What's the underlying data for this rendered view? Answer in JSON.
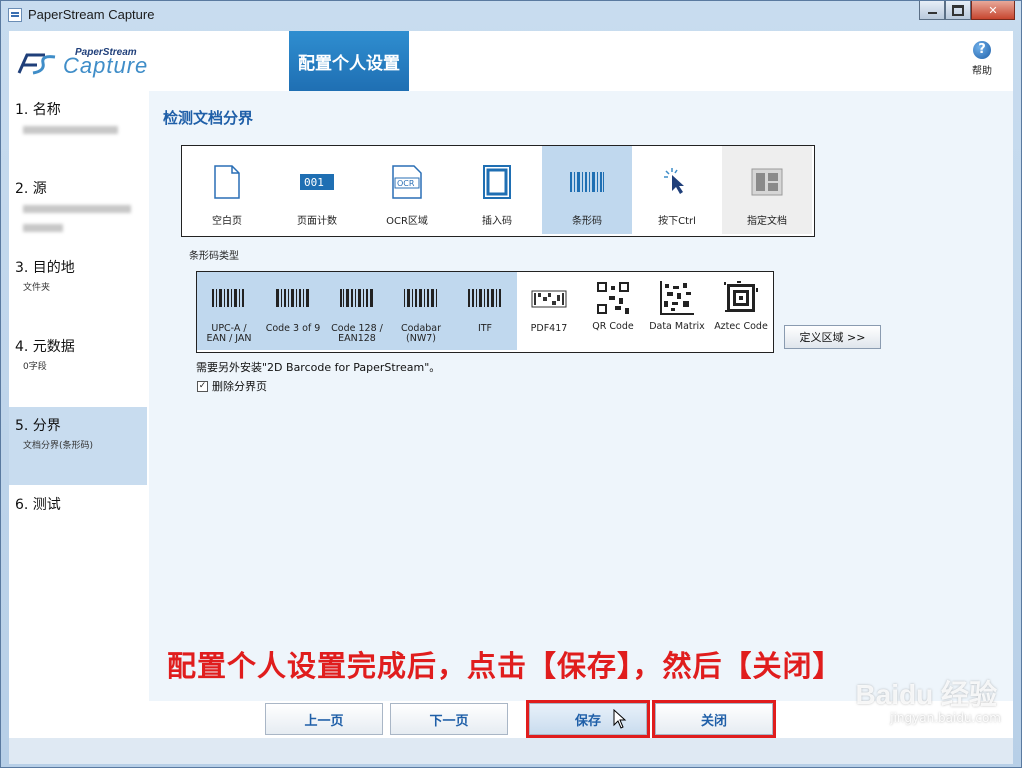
{
  "window": {
    "title": "PaperStream Capture"
  },
  "header": {
    "logo_top": "PaperStream",
    "logo_main": "Capture",
    "page_tab": "配置个人设置",
    "help_label": "帮助"
  },
  "sidebar": {
    "steps": [
      {
        "title": "1. 名称",
        "sub": ""
      },
      {
        "title": "2. 源",
        "sub": ""
      },
      {
        "title": "3. 目的地",
        "sub": "文件夹"
      },
      {
        "title": "4. 元数据",
        "sub": "0字段"
      },
      {
        "title": "5. 分界",
        "sub": "文档分界(条形码)"
      },
      {
        "title": "6. 测试",
        "sub": ""
      }
    ]
  },
  "main": {
    "section_title": "检测文档分界",
    "modes": [
      {
        "label": "空白页",
        "icon": "blank-page-icon"
      },
      {
        "label": "页面计数",
        "icon": "page-counter-icon"
      },
      {
        "label": "OCR区域",
        "icon": "ocr-icon"
      },
      {
        "label": "插入码",
        "icon": "patch-code-icon"
      },
      {
        "label": "条形码",
        "icon": "barcode-icon"
      },
      {
        "label": "按下Ctrl",
        "icon": "pointer-icon"
      },
      {
        "label": "指定文档",
        "icon": "document-layout-icon"
      }
    ],
    "barcode_type_label": "条形码类型",
    "barcodes": [
      {
        "label": "UPC-A /\nEAN / JAN"
      },
      {
        "label": "Code 3 of 9"
      },
      {
        "label": "Code 128 /\nEAN128"
      },
      {
        "label": "Codabar\n(NW7)"
      },
      {
        "label": "ITF"
      },
      {
        "label": "PDF417"
      },
      {
        "label": "QR Code"
      },
      {
        "label": "Data Matrix"
      },
      {
        "label": "Aztec Code"
      }
    ],
    "define_button": "定义区域 >>",
    "note": "需要另外安装\"2D Barcode for PaperStream\"。",
    "checkbox_label": "删除分界页",
    "checkbox_checked": true,
    "annotation": "配置个人设置完成后，点击【保存】，然后【关闭】"
  },
  "footer": {
    "prev": "上一页",
    "next": "下一页",
    "save": "保存",
    "close": "关闭"
  },
  "watermark": {
    "main": "Baidu 经验",
    "sub": "jingyan.baidu.com"
  },
  "colors": {
    "accent": "#1f6fb3",
    "selected": "#c0d8ee",
    "annotation": "#e01d1d"
  }
}
